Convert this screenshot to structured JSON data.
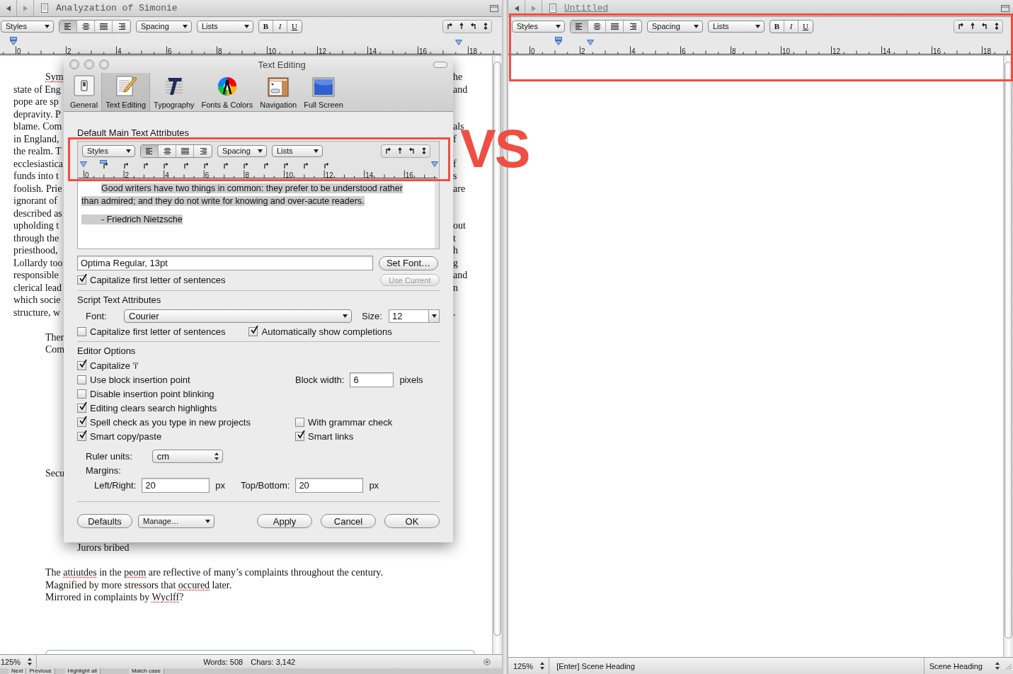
{
  "left_window": {
    "title": "Analyzation of Simonie",
    "toolbar": {
      "styles": "Styles",
      "alignment": [
        {
          "kind": "left",
          "selected": true
        },
        {
          "kind": "center",
          "selected": false
        },
        {
          "kind": "justify",
          "selected": false
        },
        {
          "kind": "right",
          "selected": false
        }
      ],
      "spacing": "Spacing",
      "lists": "Lists",
      "format": [
        "B",
        "I",
        "U"
      ]
    },
    "ruler": [
      "0",
      "2",
      "4",
      "6",
      "8",
      "10",
      "12",
      "14",
      "16",
      "18"
    ],
    "document": [
      {
        "kind": "indented",
        "segments": [
          {
            "text": "Sym",
            "misspelled": true
          }
        ],
        "right": "he"
      },
      {
        "kind": "body",
        "text": "state of Eng",
        "right": "and"
      },
      {
        "kind": "body",
        "text": "pope are sp"
      },
      {
        "kind": "body",
        "text": "depravity. P"
      },
      {
        "kind": "body",
        "text": "blame. Com",
        "right": "als"
      },
      {
        "kind": "body",
        "text": "in England,",
        "right": "f"
      },
      {
        "kind": "body",
        "text": "the realm. T"
      },
      {
        "kind": "body",
        "text": "ecclesiastica",
        "right": "f"
      },
      {
        "kind": "body",
        "text": "funds into t",
        "right": "s"
      },
      {
        "kind": "body",
        "text": "foolish. Prie",
        "right": "are"
      },
      {
        "kind": "body",
        "text": "ignorant of"
      },
      {
        "kind": "body",
        "text": "described as"
      },
      {
        "kind": "body",
        "text": "upholding t",
        "right": "out"
      },
      {
        "kind": "body",
        "text": "through the",
        "right": "t"
      },
      {
        "kind": "body",
        "text": "priesthood,",
        "right": "h"
      },
      {
        "kind": "body",
        "text": "Lollardy too",
        "right": "g"
      },
      {
        "kind": "body",
        "text": "responsible",
        "right": "and"
      },
      {
        "kind": "body",
        "text": "clerical lead",
        "right": "n"
      },
      {
        "kind": "body",
        "text": "which socie"
      },
      {
        "kind": "body",
        "text": "structure, w",
        "right": "."
      },
      {
        "kind": "blank"
      },
      {
        "kind": "indented",
        "text": "Ther"
      },
      {
        "kind": "indented",
        "text": "Com"
      },
      {
        "kind": "blank"
      },
      {
        "kind": "blank"
      },
      {
        "kind": "blank"
      },
      {
        "kind": "blank"
      },
      {
        "kind": "blank"
      },
      {
        "kind": "blank"
      },
      {
        "kind": "blank"
      },
      {
        "kind": "blank"
      },
      {
        "kind": "blank"
      },
      {
        "kind": "indented",
        "text": "Secu"
      },
      {
        "kind": "blank"
      },
      {
        "kind": "blank"
      },
      {
        "kind": "blank"
      },
      {
        "kind": "blank"
      },
      {
        "kind": "blank"
      },
      {
        "kind": "deep",
        "text": "Jurors bribed"
      },
      {
        "kind": "blank"
      },
      {
        "kind": "indented",
        "segments": [
          {
            "text": "The "
          },
          {
            "text": "attiutdes",
            "misspelled": true
          },
          {
            "text": " in the "
          },
          {
            "text": "peom",
            "misspelled": true
          },
          {
            "text": " are reflective of many’s complaints throughout the century."
          }
        ]
      },
      {
        "kind": "indented",
        "segments": [
          {
            "text": "Magnified by more stressors that "
          },
          {
            "text": "occured",
            "misspelled": true
          },
          {
            "text": " later."
          }
        ]
      },
      {
        "kind": "indented",
        "segments": [
          {
            "text": "Mirrored in complaints by "
          },
          {
            "text": "Wyclff",
            "misspelled": true
          },
          {
            "text": "?"
          }
        ]
      }
    ],
    "status": {
      "zoom": "125%",
      "words": "Words: 508",
      "chars": "Chars: 3,142"
    },
    "find_bar": [
      "Next",
      "Previous",
      "Highlight all",
      "Match case"
    ]
  },
  "right_window": {
    "title": "Untitled",
    "toolbar": {
      "styles": "Styles",
      "alignment": [
        {
          "kind": "left",
          "selected": true
        },
        {
          "kind": "center",
          "selected": false
        },
        {
          "kind": "justify",
          "selected": false
        },
        {
          "kind": "right",
          "selected": false
        }
      ],
      "spacing": "Spacing",
      "lists": "Lists",
      "format": [
        "B",
        "I",
        "U"
      ]
    },
    "ruler": [
      "0",
      "2",
      "4",
      "6",
      "8",
      "10",
      "12",
      "14",
      "16",
      "18"
    ],
    "status": {
      "zoom": "125%",
      "element": "[Enter] Scene Heading",
      "element_type": "Scene Heading"
    }
  },
  "dialog": {
    "title": "Text Editing",
    "tabs": [
      {
        "kind": "general",
        "label": "General",
        "selected": false
      },
      {
        "kind": "editing",
        "label": "Text Editing",
        "selected": true
      },
      {
        "kind": "typography",
        "label": "Typography",
        "selected": false
      },
      {
        "kind": "colors",
        "label": "Fonts & Colors",
        "selected": false
      },
      {
        "kind": "navigation",
        "label": "Navigation",
        "selected": false
      },
      {
        "kind": "fullscreen",
        "label": "Full Screen",
        "selected": false
      }
    ],
    "main_section": {
      "heading": "Default Main Text Attributes",
      "toolbar": {
        "styles": "Styles",
        "alignment": [
          {
            "kind": "left",
            "selected": true
          },
          {
            "kind": "center",
            "selected": false
          },
          {
            "kind": "justify",
            "selected": false
          },
          {
            "kind": "right",
            "selected": false
          }
        ],
        "spacing": "Spacing",
        "lists": "Lists"
      },
      "ruler": [
        "0",
        "2",
        "4",
        "6",
        "8",
        "10",
        "12",
        "14",
        "16"
      ],
      "sample": [
        "Good writers have two things in common: they prefer to be understood rather than admired; and they do not write for knowing and over-acute readers.",
        "- Friedrich Nietzsche"
      ],
      "font": "Optima Regular, 13pt",
      "set_font": "Set Font…",
      "capitalize": {
        "label": "Capitalize first letter of sentences",
        "checked": true
      },
      "use_current": {
        "label": "Use Current",
        "disabled": true
      }
    },
    "script_section": {
      "heading": "Script Text Attributes",
      "font_label": "Font:",
      "font": "Courier",
      "size_label": "Size:",
      "size": "12",
      "checkboxes": [
        {
          "label": "Capitalize first letter of sentences",
          "checked": false
        },
        {
          "label": "Automatically show completions",
          "checked": true
        }
      ]
    },
    "editor_section": {
      "heading": "Editor Options",
      "rows": [
        {
          "cells": [
            {
              "kind": "checkbox",
              "label": "Capitalize 'i'",
              "checked": true
            }
          ]
        },
        {
          "cells": [
            {
              "kind": "checkbox",
              "label": "Use block insertion point",
              "checked": false
            },
            {
              "kind": "number",
              "label": "Block width:",
              "value": "6",
              "unit": "pixels"
            }
          ]
        },
        {
          "cells": [
            {
              "kind": "checkbox",
              "label": "Disable insertion point blinking",
              "checked": false
            }
          ]
        },
        {
          "cells": [
            {
              "kind": "checkbox",
              "label": "Editing clears search highlights",
              "checked": true
            }
          ]
        },
        {
          "cells": [
            {
              "kind": "checkbox",
              "label": "Spell check as you type in new projects",
              "checked": true
            },
            {
              "kind": "checkbox",
              "label": "With grammar check",
              "checked": false
            }
          ]
        },
        {
          "cells": [
            {
              "kind": "checkbox",
              "label": "Smart copy/paste",
              "checked": true
            },
            {
              "kind": "checkbox",
              "label": "Smart links",
              "checked": true
            }
          ]
        }
      ],
      "ruler_units_label": "Ruler units:",
      "ruler_units": "cm",
      "margins_label": "Margins:",
      "margins": [
        {
          "label": "Left/Right:",
          "value": "20",
          "unit": "px"
        },
        {
          "label": "Top/Bottom:",
          "value": "20",
          "unit": "px"
        }
      ]
    },
    "buttons": [
      {
        "kind": "button",
        "label": "Defaults"
      },
      {
        "kind": "popup",
        "label": "Manage…"
      },
      {
        "kind": "button",
        "label": "Apply"
      },
      {
        "kind": "button",
        "label": "Cancel"
      },
      {
        "kind": "default",
        "label": "OK"
      }
    ]
  },
  "annotations": {
    "label": "VS"
  }
}
